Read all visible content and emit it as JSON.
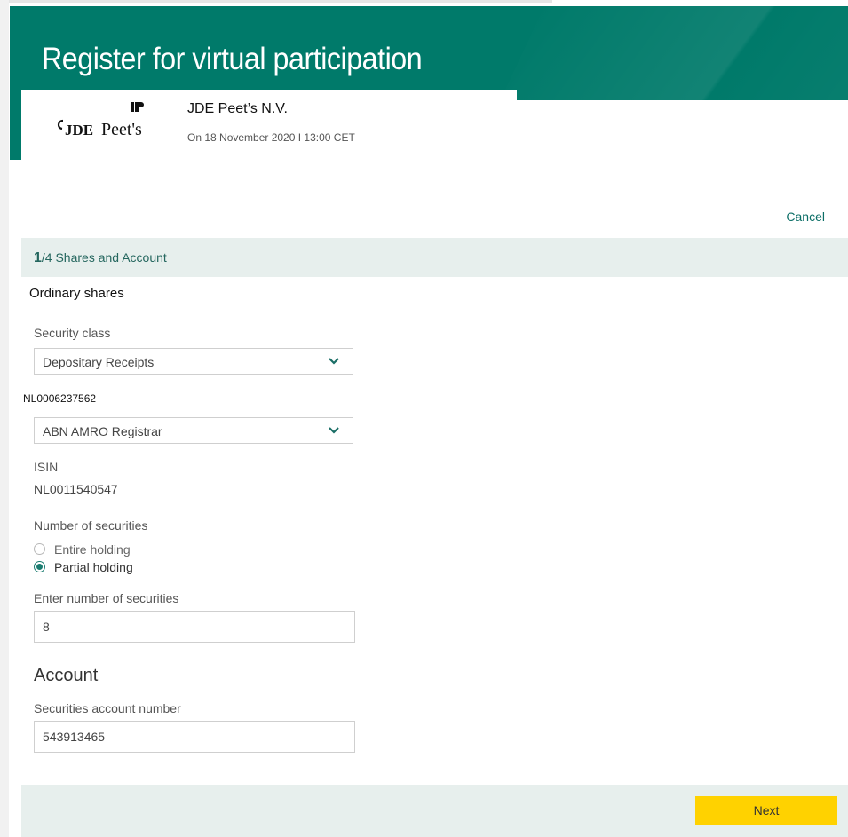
{
  "header": {
    "title": "Register for virtual participation",
    "company_name": "JDE Peet’s N.V.",
    "meeting_date": "On 18 November 2020 I 13:00 CET",
    "logo_text": "JDE Peet's"
  },
  "actions": {
    "cancel_label": "Cancel",
    "next_label": "Next"
  },
  "step": {
    "current": "1",
    "rest": "/4 Shares and Account"
  },
  "shares": {
    "heading": "Ordinary shares",
    "security_class_label": "Security class",
    "security_class_value": "Depositary Receipts",
    "security_isin_small": "NL0006237562",
    "registrar_value": "ABN AMRO Registrar",
    "isin_label": "ISIN",
    "isin_value": "NL0011540547",
    "number_label": "Number of securities",
    "options": [
      {
        "label": "Entire holding",
        "selected": false
      },
      {
        "label": "Partial holding",
        "selected": true
      }
    ],
    "enter_number_label": "Enter number of securities",
    "enter_number_value": "8"
  },
  "account": {
    "heading": "Account",
    "account_number_label": "Securities account number",
    "account_number_value": "543913465"
  },
  "colors": {
    "banner": "#007a6a",
    "accent": "#1a7c70",
    "step_bg": "#e7efed",
    "next_button": "#ffd200"
  }
}
